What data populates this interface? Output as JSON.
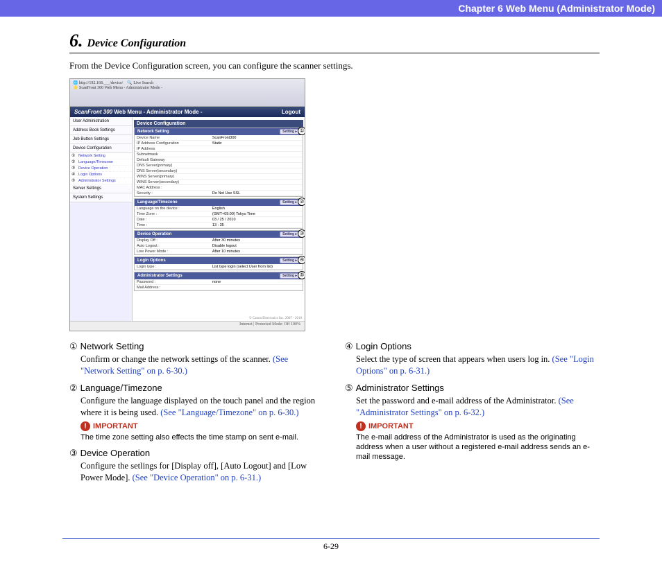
{
  "header": "Chapter 6   Web Menu (Administrator Mode)",
  "section_num": "6.",
  "section_title": "Device Configuration",
  "intro": "From the Device Configuration screen, you can configure the scanner settings.",
  "screenshot": {
    "url": "http://192.168.___/device/",
    "tab": "ScanFront 300 Web Menu - Administrator Mode -",
    "search": "Live Search",
    "brand": "ScanFront 300",
    "brand_sub": "Web Menu   - Administrator Mode -",
    "logout": "Logout",
    "sidebar_items": [
      "User Administration",
      "Address Book Settings",
      "Job Button Settings",
      "Device Configuration"
    ],
    "sidebar_subs": [
      {
        "n": "①",
        "t": "Network Setting"
      },
      {
        "n": "②",
        "t": "Language/Timezone"
      },
      {
        "n": "③",
        "t": "Device Operation"
      },
      {
        "n": "④",
        "t": "Login Options"
      },
      {
        "n": "⑤",
        "t": "Administrator Settings"
      }
    ],
    "sidebar_items2": [
      "Server Settings",
      "System Settings"
    ],
    "page_title": "Device Configuration",
    "setting_btn": "Setting",
    "sections": [
      {
        "n": "①",
        "title": "Network Setting",
        "rows": [
          [
            "Device Name",
            "ScanFront300"
          ],
          [
            "IP Address Configuration",
            "Static"
          ],
          [
            "IP Address",
            ""
          ],
          [
            "Subnetmask",
            ""
          ],
          [
            "Default Gateway",
            ""
          ],
          [
            "DNS Server(primary)",
            ""
          ],
          [
            "DNS Server(secondary)",
            ""
          ],
          [
            "WINS Server(primary)",
            ""
          ],
          [
            "WINS Server(secondary)",
            ""
          ],
          [
            "MAC Address :",
            ""
          ],
          [
            "Security :",
            "Do Not Use SSL"
          ]
        ]
      },
      {
        "n": "②",
        "title": "Language/Timezone",
        "rows": [
          [
            "Language on the device :",
            "English"
          ],
          [
            "Time Zone :",
            "(GMT+09:00) Tokyo Time"
          ],
          [
            "Date :",
            "03 / 25 / 2010"
          ],
          [
            "Time :",
            "13 : 35"
          ]
        ]
      },
      {
        "n": "③",
        "title": "Device Operation",
        "rows": [
          [
            "Display Off :",
            "After 30 minutes"
          ],
          [
            "Auto Logout :",
            "Disable logout"
          ],
          [
            "Low Power Mode :",
            "After 10 minutes"
          ]
        ]
      },
      {
        "n": "④",
        "title": "Login Options",
        "rows": [
          [
            "Login type :",
            "List type login (select User from list)"
          ]
        ]
      },
      {
        "n": "⑤",
        "title": "Administrator Settings",
        "rows": [
          [
            "Password :",
            "none"
          ],
          [
            "Mail Address :",
            ""
          ]
        ]
      }
    ],
    "copyright": "© Canon Electronics Inc. 2007 - 2010",
    "status": "Internet | Protected Mode: Off        100%"
  },
  "entries_left": [
    {
      "n": "①",
      "h": "Network Setting",
      "b": "Confirm or change the network settings of the scanner. ",
      "l": "(See \"Network Setting\" on p. 6-30.)"
    },
    {
      "n": "②",
      "h": "Language/Timezone",
      "b": "Configure the language displayed on the touch panel and the region where it is being used. ",
      "l": "(See \"Language/Timezone\" on p. 6-30.)",
      "imp": "The time zone setting also effects the time stamp on sent e-mail."
    },
    {
      "n": "③",
      "h": "Device Operation",
      "b": "Configure the setlings for [Display off], [Auto Logout] and [Low Power Mode]. ",
      "l": "(See \"Device Operation\" on p. 6-31.)"
    }
  ],
  "entries_right": [
    {
      "n": "④",
      "h": "Login Options",
      "b": "Select the type of screen that appears when users log in. ",
      "l": "(See \"Login Options\" on p. 6-31.)"
    },
    {
      "n": "⑤",
      "h": "Administrator Settings",
      "b": "Set the password and e-mail address of the Administrator. ",
      "l": "(See \"Administrator Settings\" on p. 6-32.)",
      "imp": "The e-mail address of the Administrator is used as the originating address when a user without a registered e-mail address sends an e-mail message."
    }
  ],
  "important_label": "IMPORTANT",
  "page_num": "6-29"
}
